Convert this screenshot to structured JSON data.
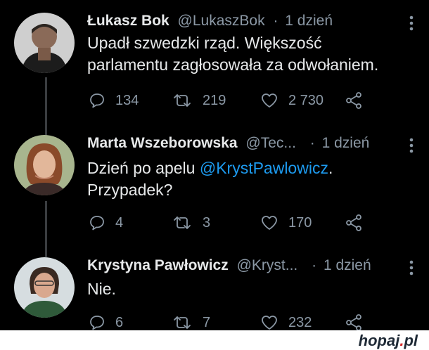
{
  "tweets": [
    {
      "name": "Łukasz Bok",
      "handle": "@LukaszBok",
      "sep": "·",
      "time": "1 dzień",
      "text_lines": [
        "Upadł szwedzki rząd. Większość",
        "parlamentu zagłosowała za odwołaniem."
      ],
      "replies": "134",
      "retweets": "219",
      "likes": "2 730"
    },
    {
      "name": "Marta Wszeborowska",
      "handle": "@Tec...",
      "sep": "·",
      "time": "1 dzień",
      "text_line1_prefix": "Dzień po apelu ",
      "mention": "@KrystPawlowicz",
      "text_line1_suffix": ".",
      "text_line2": "Przypadek?",
      "replies": "4",
      "retweets": "3",
      "likes": "170"
    },
    {
      "name": "Krystyna Pawłowicz",
      "handle": "@Kryst...",
      "sep": "·",
      "time": "1 dzień",
      "text": "Nie.",
      "replies": "6",
      "retweets": "7",
      "likes": "232"
    }
  ],
  "footer": {
    "brand_main": "hopaj",
    "brand_dot": ".",
    "brand_tld": "pl"
  },
  "colors": {
    "background": "#000000",
    "text": "#e7e9ea",
    "muted": "#8b98a5",
    "link": "#1d9bf0"
  },
  "icons": [
    "reply-icon",
    "retweet-icon",
    "like-icon",
    "share-icon",
    "more-icon"
  ]
}
